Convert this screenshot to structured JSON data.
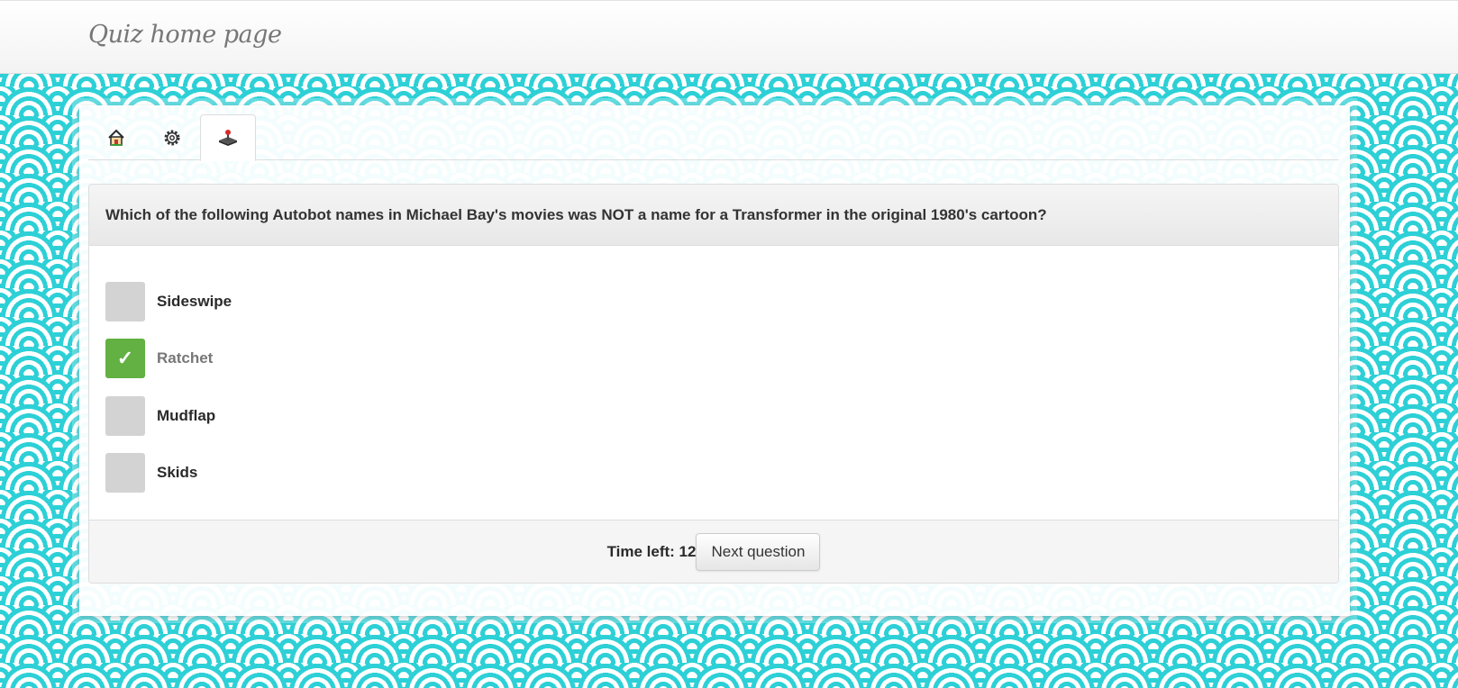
{
  "app": {
    "title": "Quiz home page"
  },
  "tabs": [
    {
      "icon": "home-icon",
      "active": false
    },
    {
      "icon": "gear-icon",
      "active": false
    },
    {
      "icon": "joystick-icon",
      "active": true
    }
  ],
  "quiz": {
    "question": "Which of the following Autobot names in Michael Bay's movies was NOT a name for a Transformer in the original 1980's cartoon?",
    "options": [
      {
        "label": "Sideswipe",
        "checked": false
      },
      {
        "label": "Ratchet",
        "checked": true
      },
      {
        "label": "Mudflap",
        "checked": false
      },
      {
        "label": "Skids",
        "checked": false
      }
    ],
    "check_mark": "✓",
    "timer_label": "Time left: 12",
    "next_button_label": "Next question"
  },
  "colors": {
    "pattern": "#2dd0d6",
    "checked": "#62b142",
    "unchecked": "#d3d3d3"
  }
}
